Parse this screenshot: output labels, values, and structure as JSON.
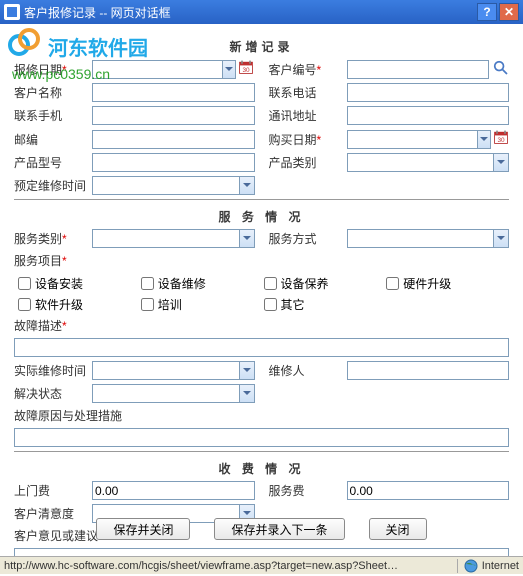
{
  "title": "客户报修记录 -- 网页对话框",
  "watermark": {
    "text": "河东软件园",
    "url": "www.pc0359.cn"
  },
  "section_add": "新增记录",
  "section_service": "服 务 情 况",
  "section_fee": "收 费 情 况",
  "labels": {
    "report_date": "报修日期",
    "customer_id": "客户编号",
    "customer_name": "客户名称",
    "phone": "联系电话",
    "mobile": "联系手机",
    "address": "通讯地址",
    "postcode": "邮编",
    "buy_date": "购买日期",
    "product_model": "产品型号",
    "product_type": "产品类别",
    "schedule_time": "预定维修时间",
    "service_type": "服务类别",
    "service_mode": "服务方式",
    "service_item": "服务项目",
    "fault_desc": "故障描述",
    "actual_time": "实际维修时间",
    "repairer": "维修人",
    "solve_status": "解决状态",
    "fault_reason": "故障原因与处理措施",
    "visit_fee": "上门费",
    "service_fee": "服务费",
    "satisfaction": "客户清意度",
    "suggestion": "客户意见或建议"
  },
  "checks": {
    "install": "设备安装",
    "repair": "设备维修",
    "maintain": "设备保养",
    "hw_upgrade": "硬件升级",
    "sw_upgrade": "软件升级",
    "training": "培训",
    "other": "其它"
  },
  "values": {
    "visit_fee": "0.00",
    "service_fee": "0.00"
  },
  "buttons": {
    "save_close": "保存并关闭",
    "save_next": "保存并录入下一条",
    "close": "关闭"
  },
  "status": {
    "url": "http://www.hc-software.com/hcgis/sheet/viewframe.asp?target=new.asp?Sheet…",
    "zone": "Internet"
  }
}
